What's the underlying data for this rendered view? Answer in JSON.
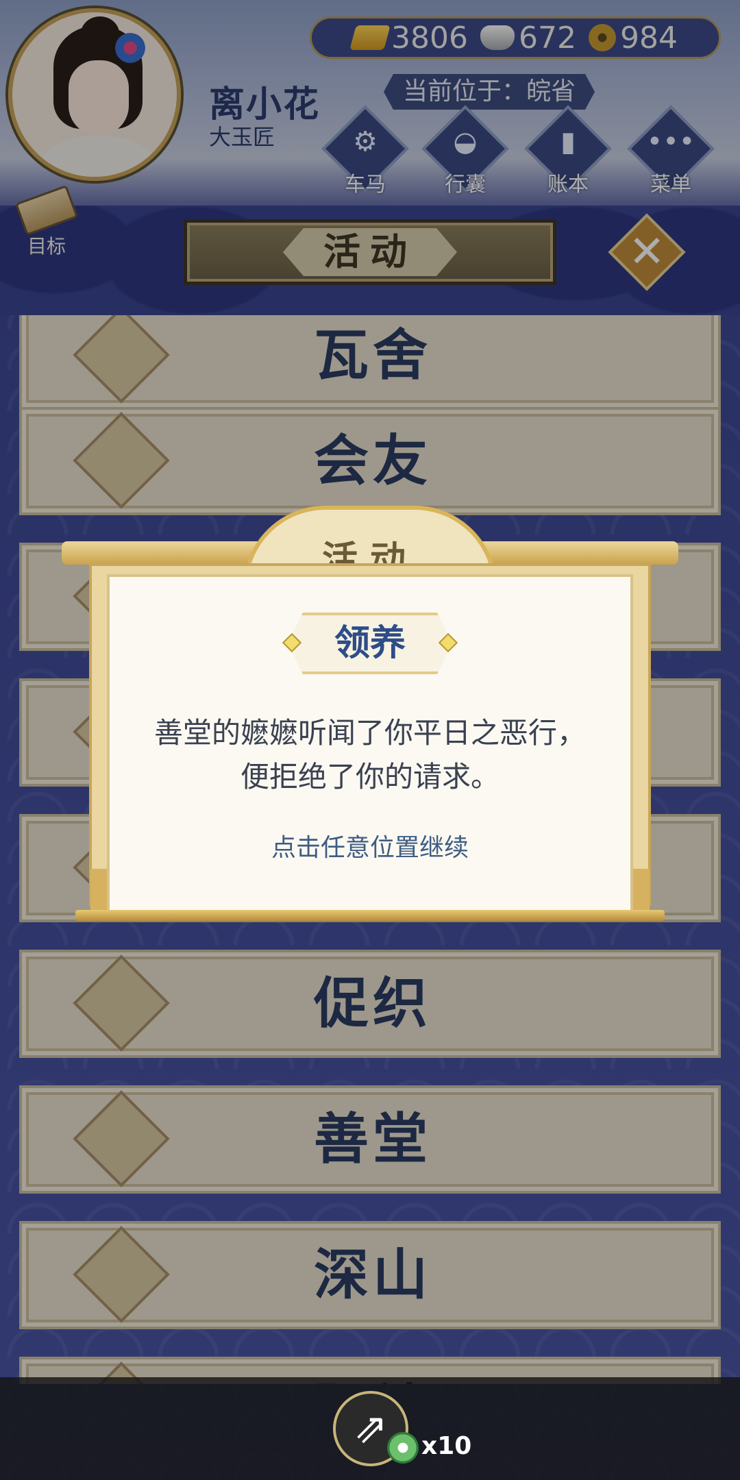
{
  "player": {
    "name": "离小花",
    "title": "大玉匠"
  },
  "currency": {
    "gold": "3806",
    "silver": "672",
    "coins": "984"
  },
  "location": "当前位于：皖省",
  "top_buttons": [
    {
      "label": "车马",
      "icon": "carriage-icon"
    },
    {
      "label": "行囊",
      "icon": "bag-icon"
    },
    {
      "label": "账本",
      "icon": "ledger-icon"
    },
    {
      "label": "菜单",
      "icon": "menu-icon"
    }
  ],
  "goal": {
    "label": "目标",
    "icon": "scroll-icon"
  },
  "banner": {
    "title": "活动"
  },
  "close": {
    "icon": "close-icon"
  },
  "list": [
    {
      "label": "瓦舍",
      "icon": "performer-icon"
    },
    {
      "label": "会友",
      "icon": "teahouse-icon"
    },
    {
      "label": "",
      "icon": "incense-icon"
    },
    {
      "label": "",
      "icon": "gate-icon"
    },
    {
      "label": "",
      "icon": "pagoda-icon"
    },
    {
      "label": "促织",
      "icon": "cricket-icon"
    },
    {
      "label": "善堂",
      "icon": "hall-icon"
    },
    {
      "label": "深山",
      "icon": "mountain-icon"
    },
    {
      "label": "驿站",
      "icon": "post-station-icon"
    }
  ],
  "dialog": {
    "title": "活动",
    "subtitle": "领养",
    "message_line1": "善堂的嬷嬷听闻了你平日之恶行，",
    "message_line2": "便拒绝了你的请求。",
    "hint": "点击任意位置继续"
  },
  "bottom": {
    "share_icon": "share-icon",
    "token_count": "x10"
  }
}
